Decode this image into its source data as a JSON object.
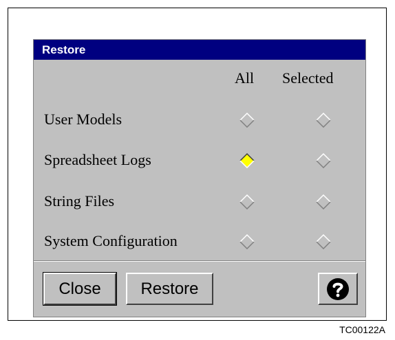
{
  "figure_label": "TC00122A",
  "dialog": {
    "title": "Restore",
    "columns": {
      "all": "All",
      "selected": "Selected"
    },
    "rows": [
      {
        "label": "User Models",
        "all": false,
        "selected": false
      },
      {
        "label": "Spreadsheet Logs",
        "all": true,
        "selected": false
      },
      {
        "label": "String Files",
        "all": false,
        "selected": false
      },
      {
        "label": "System Configuration",
        "all": false,
        "selected": false
      }
    ],
    "buttons": {
      "close": "Close",
      "restore": "Restore",
      "help_icon": "question-icon"
    }
  },
  "colors": {
    "titlebar": "#000080",
    "dialog_bg": "#c0c0c0",
    "radio_selected_fill": "#ffff00"
  }
}
